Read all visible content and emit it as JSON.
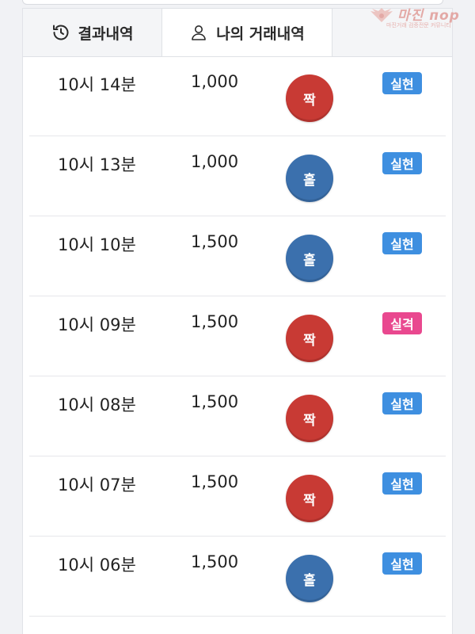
{
  "tabs": {
    "history": {
      "label": "결과내역",
      "icon": "history-icon"
    },
    "mine": {
      "label": "나의 거래내역",
      "icon": "user-icon"
    }
  },
  "logo": {
    "name": "마진",
    "suffix": "пор",
    "tagline": "마진거래 검증전문 커뮤니티"
  },
  "colors": {
    "even_ball": "#c83a34",
    "odd_ball": "#3b70ad",
    "result_win": "#3e8fe0",
    "result_lose": "#e9488f"
  },
  "rows": [
    {
      "time": "10시 14분",
      "amount": "1,000",
      "pick": "짝",
      "pick_type": "even",
      "result": "실현",
      "result_type": "win"
    },
    {
      "time": "10시 13분",
      "amount": "1,000",
      "pick": "홀",
      "pick_type": "odd",
      "result": "실현",
      "result_type": "win"
    },
    {
      "time": "10시 10분",
      "amount": "1,500",
      "pick": "홀",
      "pick_type": "odd",
      "result": "실현",
      "result_type": "win"
    },
    {
      "time": "10시 09분",
      "amount": "1,500",
      "pick": "짝",
      "pick_type": "even",
      "result": "실격",
      "result_type": "lose"
    },
    {
      "time": "10시 08분",
      "amount": "1,500",
      "pick": "짝",
      "pick_type": "even",
      "result": "실현",
      "result_type": "win"
    },
    {
      "time": "10시 07분",
      "amount": "1,500",
      "pick": "짝",
      "pick_type": "even",
      "result": "실현",
      "result_type": "win"
    },
    {
      "time": "10시 06분",
      "amount": "1,500",
      "pick": "홀",
      "pick_type": "odd",
      "result": "실현",
      "result_type": "win"
    }
  ]
}
